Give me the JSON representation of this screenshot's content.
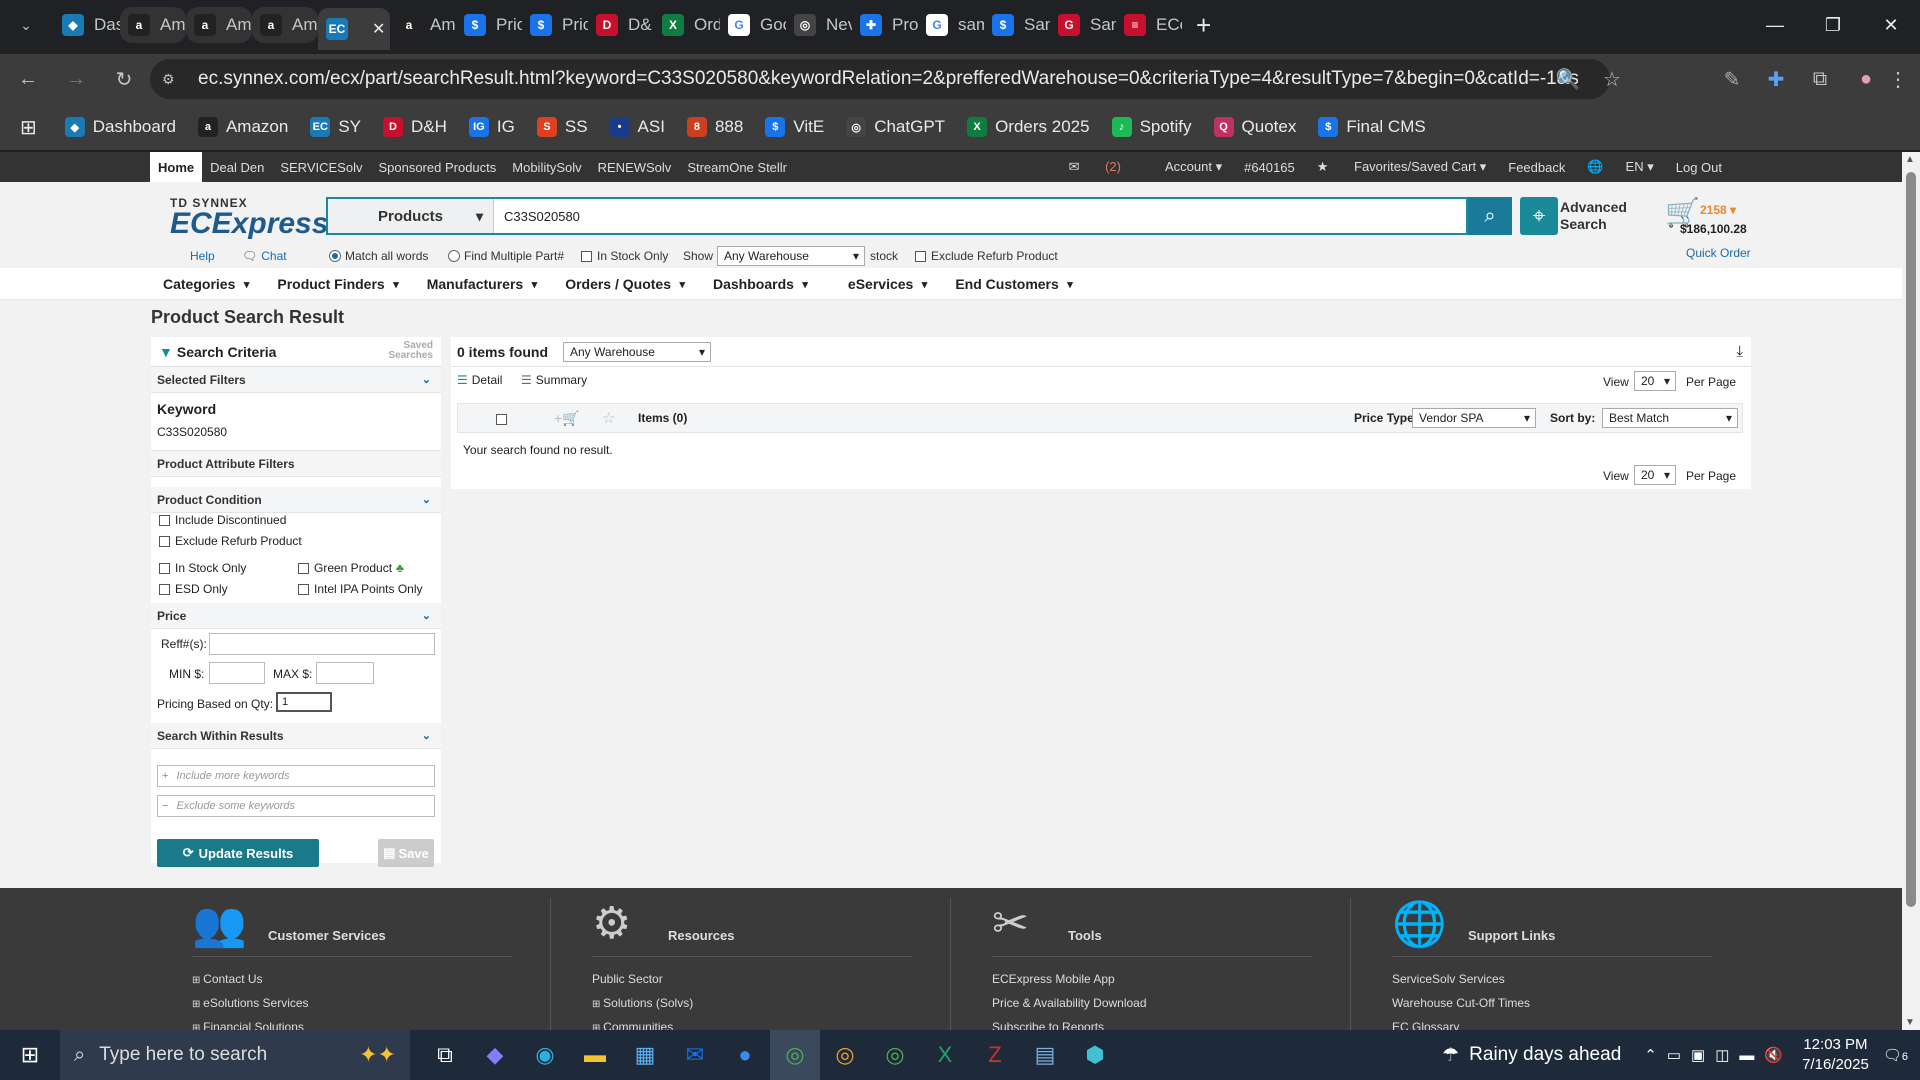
{
  "browser": {
    "tabs": [
      {
        "label": "Das",
        "icon": "ec-icon",
        "color": "#1a7ab5",
        "fav": "◆"
      },
      {
        "label": "Am",
        "icon": "amazon-icon",
        "color": "#222",
        "fav": "a"
      },
      {
        "label": "Am",
        "icon": "amazon-icon",
        "color": "#222",
        "fav": "a"
      },
      {
        "label": "Am",
        "icon": "amazon-icon",
        "color": "#222",
        "fav": "a"
      },
      {
        "label": "",
        "icon": "ec-icon",
        "color": "#1a7ab5",
        "fav": "EC"
      },
      {
        "label": "Am",
        "icon": "amazon-icon",
        "color": "#222",
        "fav": "a"
      },
      {
        "label": "Pric",
        "icon": "s-icon",
        "color": "#1a73e8",
        "fav": "$"
      },
      {
        "label": "Pric",
        "icon": "s-icon",
        "color": "#1a73e8",
        "fav": "$"
      },
      {
        "label": "D&",
        "icon": "dh-icon",
        "color": "#c8102e",
        "fav": "D"
      },
      {
        "label": "Ord",
        "icon": "excel-icon",
        "color": "#107c41",
        "fav": "X"
      },
      {
        "label": "Goo",
        "icon": "google-icon",
        "color": "#fff",
        "fav": "G"
      },
      {
        "label": "Nev",
        "icon": "chatgpt-icon",
        "color": "#444",
        "fav": "◎"
      },
      {
        "label": "Pro",
        "icon": "puzzle-icon",
        "color": "#1a73e8",
        "fav": "✚"
      },
      {
        "label": "sam",
        "icon": "google-icon",
        "color": "#fff",
        "fav": "G"
      },
      {
        "label": "San",
        "icon": "s-icon",
        "color": "#1a73e8",
        "fav": "$"
      },
      {
        "label": "San",
        "icon": "g-red-icon",
        "color": "#c8102e",
        "fav": "G"
      },
      {
        "label": "ECo",
        "icon": "stack-icon",
        "color": "#c8102e",
        "fav": "≡"
      }
    ],
    "url": "ec.synnex.com/ecx/part/searchResult.html?keyword=C33S020580&keywordRelation=2&prefferedWarehouse=0&criteriaType=4&resultType=7&begin=0&catId=-1&suggestio...",
    "bookmarks": [
      {
        "label": "Dashboard",
        "color": "#1a7ab5",
        "fav": "◆"
      },
      {
        "label": "Amazon",
        "color": "#222",
        "fav": "a"
      },
      {
        "label": "SY",
        "color": "#1a7ab5",
        "fav": "EC"
      },
      {
        "label": "D&H",
        "color": "#c8102e",
        "fav": "D"
      },
      {
        "label": "IG",
        "color": "#1a73e8",
        "fav": "IG"
      },
      {
        "label": "SS",
        "color": "#e04020",
        "fav": "S"
      },
      {
        "label": "ASI",
        "color": "#1a3a8a",
        "fav": "•"
      },
      {
        "label": "888",
        "color": "#c84020",
        "fav": "8"
      },
      {
        "label": "VitE",
        "color": "#1a73e8",
        "fav": "$"
      },
      {
        "label": "ChatGPT",
        "color": "#444",
        "fav": "◎"
      },
      {
        "label": "Orders 2025",
        "color": "#107c41",
        "fav": "X"
      },
      {
        "label": "Spotify",
        "color": "#1db954",
        "fav": "♪"
      },
      {
        "label": "Quotex",
        "color": "#c03060",
        "fav": "Q"
      },
      {
        "label": "Final CMS",
        "color": "#1a73e8",
        "fav": "$"
      }
    ]
  },
  "site": {
    "topnav": [
      "Home",
      "Deal Den",
      "SERVICESolv",
      "Sponsored Products",
      "MobilitySolv",
      "RENEWSolv",
      "StreamOne Stellr"
    ],
    "topright": {
      "messages": "(2)",
      "account": "Account",
      "account_no": "#640165",
      "favorites": "Favorites/Saved Cart",
      "feedback": "Feedback",
      "lang": "EN",
      "logout": "Log Out"
    },
    "logo_top": "TD SYNNEX",
    "logo_main": "ECExpress",
    "search": {
      "category": "Products",
      "query": "C33S020580"
    },
    "advanced": "Advanced Search",
    "cart": {
      "count": "2158",
      "amount": "$186,100.28",
      "quick_order": "Quick Order"
    },
    "help": "Help",
    "chat": "Chat",
    "match_all": "Match all words",
    "find_multiple": "Find Multiple Part#",
    "in_stock_only": "In Stock Only",
    "show": "Show",
    "warehouse": "Any Warehouse",
    "stock": "stock",
    "exclude_refurb": "Exclude Refurb Product",
    "mainnav": [
      "Categories",
      "Product Finders",
      "Manufacturers",
      "Orders / Quotes",
      "Dashboards",
      "eServices",
      "End Customers"
    ],
    "page_title": "Product Search Result",
    "criteria": {
      "title": "Search Criteria",
      "saved": "Saved Searches",
      "selected_filters": "Selected Filters",
      "keyword_label": "Keyword",
      "keyword": "C33S020580",
      "attr_filters": "Product Attribute Filters",
      "condition": "Product Condition",
      "include_disc": "Include Discontinued",
      "exclude_refurb": "Exclude Refurb Product",
      "in_stock": "In Stock Only",
      "green": "Green Product",
      "esd": "ESD Only",
      "intel": "Intel IPA Points Only",
      "price": "Price",
      "reff": "Reff#(s):",
      "min": "MIN $:",
      "max": "MAX $:",
      "qty_label": "Pricing Based on Qty:",
      "qty": "1",
      "within": "Search Within Results",
      "include_ph": "Include more keywords",
      "exclude_ph": "Exclude some keywords",
      "update": "Update Results",
      "save": "Save"
    },
    "results": {
      "found": "0 items found",
      "warehouse": "Any Warehouse",
      "detail": "Detail",
      "summary": "Summary",
      "view": "View",
      "per_page_val": "20",
      "per_page": "Per Page",
      "items": "Items (0)",
      "price_type_label": "Price Type:",
      "price_type": "Vendor SPA",
      "sort_label": "Sort by:",
      "sort": "Best Match",
      "no_result": "Your search found no result."
    },
    "footer": [
      {
        "title": "Customer Services",
        "links": [
          "Contact Us",
          "eSolutions Services",
          "Financial Solutions"
        ]
      },
      {
        "title": "Resources",
        "links": [
          "Public Sector",
          "Solutions (Solvs)",
          "Communities"
        ]
      },
      {
        "title": "Tools",
        "links": [
          "ECExpress Mobile App",
          "Price & Availability Download",
          "Subscribe to Reports"
        ]
      },
      {
        "title": "Support Links",
        "links": [
          "ServiceSolv Services",
          "Warehouse Cut-Off Times",
          "EC Glossary"
        ]
      }
    ]
  },
  "taskbar": {
    "search_placeholder": "Type here to search",
    "weather": "Rainy days ahead",
    "time": "12:03 PM",
    "date": "7/16/2025",
    "notif_count": "6"
  }
}
